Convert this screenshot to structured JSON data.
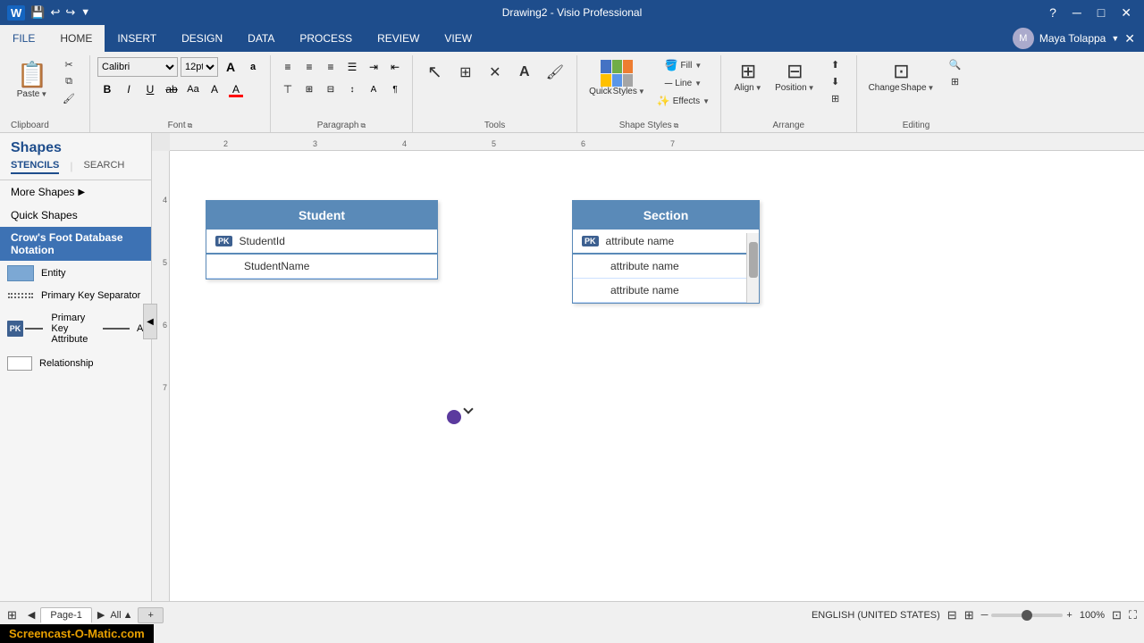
{
  "titleBar": {
    "appIcon": "W",
    "title": "Drawing2 - Visio Professional",
    "helpBtn": "?",
    "minBtn": "─",
    "maxBtn": "□",
    "closeBtn": "✕",
    "closeX": "✕"
  },
  "menuBar": {
    "items": [
      "FILE",
      "HOME",
      "INSERT",
      "DESIGN",
      "DATA",
      "PROCESS",
      "REVIEW",
      "VIEW"
    ],
    "activeItem": "HOME",
    "user": "Maya Tolappa"
  },
  "ribbon": {
    "clipboard": {
      "label": "Clipboard",
      "paste": "Paste",
      "cut": "✂",
      "copy": "⧉",
      "formatPainter": "🖌"
    },
    "font": {
      "label": "Font",
      "fontName": "Calibri",
      "fontSize": "12pt.",
      "growFont": "A",
      "shrinkFont": "a",
      "bold": "B",
      "italic": "I",
      "underline": "U",
      "strikethrough": "ab̶c",
      "moreBtn": "A",
      "fontColor": "A"
    },
    "paragraph": {
      "label": "Paragraph",
      "alignLeft": "≡",
      "alignCenter": "≡",
      "alignRight": "≡",
      "list": "☰",
      "indent": "⇥",
      "alignTop": "⊤",
      "alignMiddle": "⊥",
      "alignBottom": "↧",
      "lineSpacing": "↕",
      "decreaseIndent": "⇤"
    },
    "tools": {
      "label": "Tools",
      "pointer": "↖",
      "connection": "⊞",
      "text": "A",
      "formatPainter": "🖌"
    },
    "shapeStyles": {
      "label": "Shape Styles",
      "quickStyles": "Quick\nStyles",
      "fill": "Fill",
      "line": "Line",
      "effects": "Effects"
    },
    "arrange": {
      "label": "Arrange",
      "align": "Align",
      "position": "Position",
      "moreShapes": "⊞"
    },
    "editing": {
      "label": "Editing",
      "findReplace": "🔍",
      "changeShape": "Change\nShape"
    }
  },
  "shapesPanel": {
    "title": "Shapes",
    "tabs": [
      "STENCILS",
      "SEARCH"
    ],
    "activeTab": "STENCILS",
    "menuItems": [
      {
        "label": "More Shapes",
        "hasArrow": true
      },
      {
        "label": "Quick Shapes",
        "hasArrow": false
      }
    ],
    "activeSection": "Crow's Foot Database Notation",
    "shapeItems": [
      {
        "icon": "entity",
        "label": "Entity"
      },
      {
        "icon": "pk-sep",
        "label": "Primary Key Separator"
      },
      {
        "icon": "pk-attr",
        "label": "Primary Key Attribute"
      },
      {
        "icon": "attr",
        "label": "Attribute"
      },
      {
        "icon": "rel",
        "label": "Relationship"
      }
    ]
  },
  "canvas": {
    "studentTable": {
      "title": "Student",
      "rows": [
        {
          "pk": true,
          "label": "StudentId"
        },
        {
          "pk": false,
          "label": "StudentName"
        }
      ]
    },
    "sectionTable": {
      "title": "Section",
      "rows": [
        {
          "pk": true,
          "label": "attribute name"
        },
        {
          "pk": false,
          "label": "attribute name"
        },
        {
          "pk": false,
          "label": "attribute name"
        }
      ]
    }
  },
  "statusBar": {
    "language": "ENGLISH (UNITED STATES)",
    "pageName": "Page-1",
    "allPages": "All",
    "addPage": "+",
    "zoom": "100%"
  },
  "watermark": "Screencast-O-Matic.com"
}
